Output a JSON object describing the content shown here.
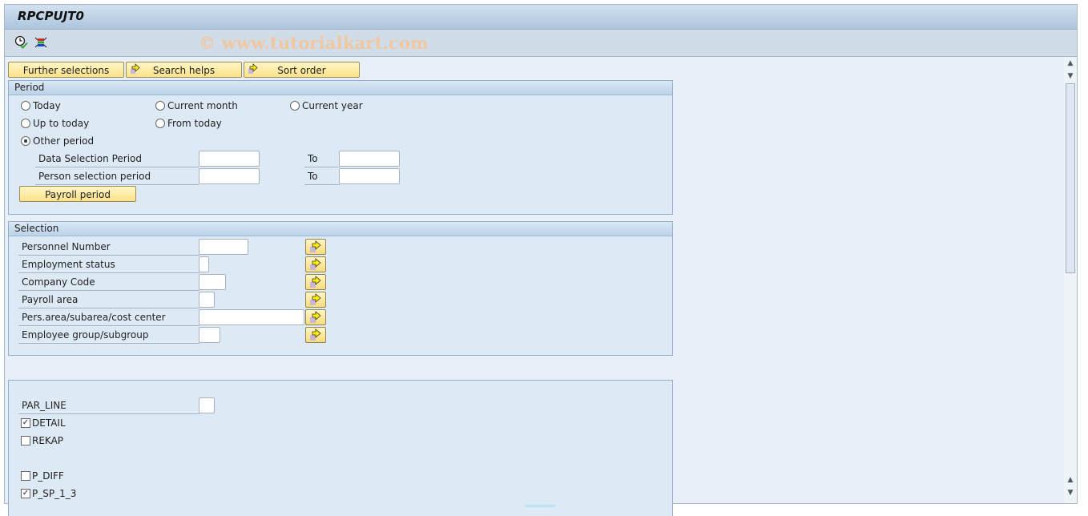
{
  "window": {
    "title": "RPCPUJT0",
    "watermark": "© www.tutorialkart.com"
  },
  "toolbar": {
    "icons": [
      {
        "name": "execute-clock-icon",
        "tooltip": ""
      },
      {
        "name": "selection-screen-icon",
        "tooltip": ""
      }
    ]
  },
  "buttons": {
    "further_selections": "Further selections",
    "search_helps": "Search helps",
    "sort_order": "Sort order"
  },
  "period": {
    "header": "Period",
    "radios": [
      {
        "label": "Today",
        "selected": false
      },
      {
        "label": "Current month",
        "selected": false
      },
      {
        "label": "Current year",
        "selected": false
      },
      {
        "label": "Up to today",
        "selected": false
      },
      {
        "label": "From today",
        "selected": false
      },
      {
        "label": "Other period",
        "selected": true
      }
    ],
    "data_selection_label": "Data Selection Period",
    "data_selection_from": "",
    "data_selection_to": "",
    "person_selection_label": "Person selection period",
    "person_selection_from": "",
    "person_selection_to": "",
    "to_label": "To",
    "payroll_period_button": "Payroll period"
  },
  "selection": {
    "header": "Selection",
    "fields": [
      {
        "label": "Personnel Number",
        "value": ""
      },
      {
        "label": "Employment status",
        "value": ""
      },
      {
        "label": "Company Code",
        "value": ""
      },
      {
        "label": "Payroll area",
        "value": ""
      },
      {
        "label": "Pers.area/subarea/cost center",
        "value": ""
      },
      {
        "label": "Employee group/subgroup",
        "value": ""
      }
    ]
  },
  "options": {
    "par_line_label": "PAR_LINE",
    "par_line_value": "",
    "checkboxes": [
      {
        "label": "DETAIL",
        "checked": true
      },
      {
        "label": "REKAP",
        "checked": false
      },
      {
        "label": "P_DIFF",
        "checked": false
      },
      {
        "label": "P_SP_1_3",
        "checked": true
      }
    ]
  }
}
